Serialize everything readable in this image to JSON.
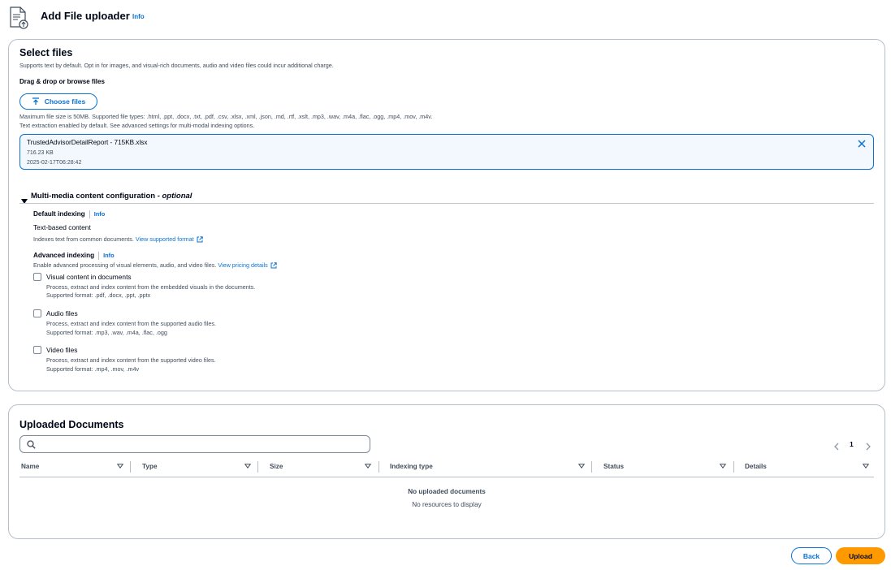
{
  "header": {
    "title": "Add File uploader",
    "info": "Info"
  },
  "select_files": {
    "title": "Select files",
    "description": "Supports text by default. Opt in for images, and visual-rich documents, audio and video files could incur additional charge.",
    "drag_label": "Drag & drop or browse files",
    "choose_button": "Choose files",
    "constraint_line1": "Maximum file size is 50MB. Supported file types: .html, .ppt, .docx, .txt, .pdf, .csv, .xlsx, .xml, .json, .md, .rtf, .xslt, .mp3, .wav, .m4a, .flac, .ogg, .mp4, .mov, .m4v.",
    "constraint_line2": "Text extraction enabled by default. See advanced settings for multi-modal indexing options.",
    "file": {
      "name": "TrustedAdvisorDetailReport - 715KB.xlsx",
      "size": "716.23 KB",
      "modified": "2025-02-17T06:28:42"
    }
  },
  "multimedia": {
    "title": "Multi-media content configuration",
    "optional": "- optional",
    "default_indexing": {
      "label": "Default indexing",
      "info": "Info",
      "value": "Text-based content",
      "description": "Indexes text from common documents.",
      "link": "View supported format"
    },
    "advanced_indexing": {
      "label": "Advanced indexing",
      "info": "Info",
      "description": "Enable advanced processing of visual elements, audio, and video files.",
      "link": "View pricing details",
      "options": [
        {
          "label": "Visual content in documents",
          "description": "Process, extract and index content from the embedded visuals in the documents.",
          "formats": "Supported format: .pdf, .docx, .ppt, .pptx",
          "checked": false
        },
        {
          "label": "Audio files",
          "description": "Process, extract and index content from the supported audio files.",
          "formats": "Supported format: .mp3, .wav, .m4a, .flac, .ogg",
          "checked": false
        },
        {
          "label": "Video files",
          "description": "Process, extract and index content from the supported video files.",
          "formats": "Supported format: .mp4, .mov, .m4v",
          "checked": false
        }
      ]
    }
  },
  "uploaded_documents": {
    "title": "Uploaded Documents",
    "search_placeholder": "",
    "page": "1",
    "columns": [
      "Name",
      "Type",
      "Size",
      "Indexing type",
      "Status",
      "Details"
    ],
    "empty_title": "No uploaded documents",
    "empty_subtitle": "No resources to display"
  },
  "footer": {
    "back_button": "Back",
    "upload_button": "Upload"
  },
  "colors": {
    "link": "#0972d3",
    "primary_button": "#ff9900",
    "border": "#b6bec9",
    "file_tile_bg": "#f2f8fd"
  }
}
